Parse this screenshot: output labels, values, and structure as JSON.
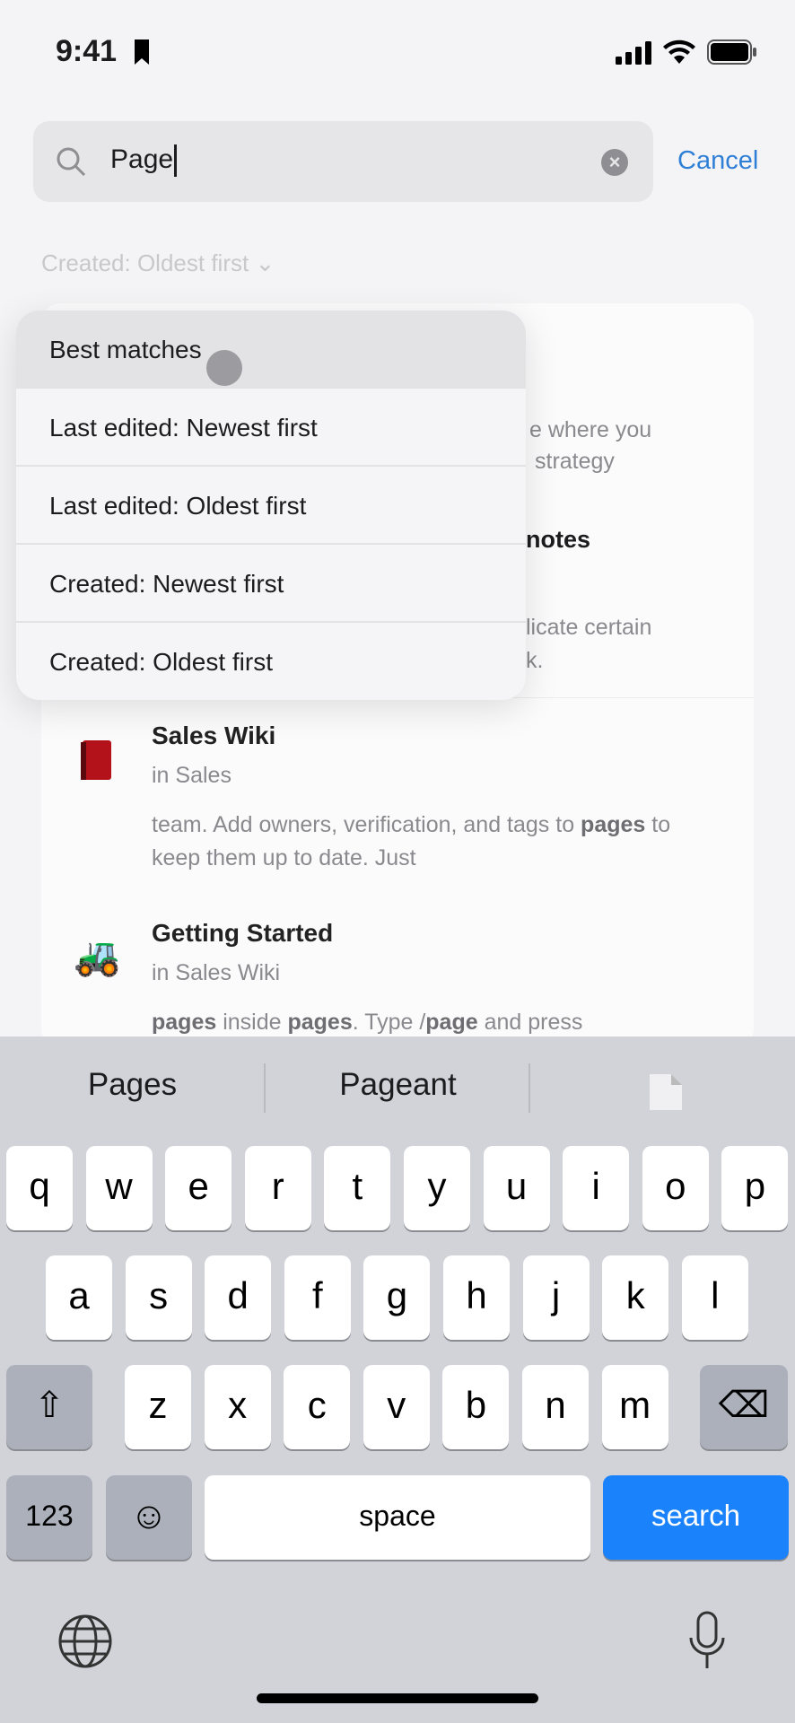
{
  "status": {
    "time": "9:41",
    "icons": [
      "bookmark-icon",
      "cellular-signal-icon",
      "wifi-icon",
      "battery-icon"
    ]
  },
  "search": {
    "value": "Page",
    "cancel_label": "Cancel",
    "icon": "search-icon",
    "clear_icon": "clear-icon"
  },
  "sort": {
    "label": "Created: Oldest first"
  },
  "results": {
    "hidden_fragments": [
      "e where you",
      "strategy",
      "notes",
      "licate certain",
      "k."
    ],
    "items": [
      {
        "icon": "red-book-emoji",
        "title": "Sales Wiki",
        "location": "in Sales",
        "snippet_parts": [
          [
            "team. Add owners, verification, and tags to ",
            false
          ],
          [
            "pages",
            true
          ],
          [
            " to keep them up to date. Just",
            false
          ]
        ]
      },
      {
        "icon": "tractor-emoji",
        "title": "Getting Started",
        "location": "in Sales Wiki",
        "snippet_parts": [
          [
            "pages",
            true
          ],
          [
            " inside ",
            false
          ],
          [
            "pages",
            true
          ],
          [
            ". Type /",
            false
          ],
          [
            "page",
            true
          ],
          [
            " and press",
            false
          ]
        ]
      }
    ]
  },
  "dropdown": {
    "selected": 0,
    "items": [
      "Best matches",
      "Last edited: Newest first",
      "Last edited: Oldest first",
      "Created: Newest first",
      "Created: Oldest first"
    ]
  },
  "keyboard": {
    "suggestions": [
      "Pages",
      "Pageant"
    ],
    "row1": [
      "q",
      "w",
      "e",
      "r",
      "t",
      "y",
      "u",
      "i",
      "o",
      "p"
    ],
    "row2": [
      "a",
      "s",
      "d",
      "f",
      "g",
      "h",
      "j",
      "k",
      "l"
    ],
    "row3": [
      "z",
      "x",
      "c",
      "v",
      "b",
      "n",
      "m"
    ],
    "numbers_label": "123",
    "space_label": "space",
    "search_label": "search",
    "accent": "#1a82fb"
  }
}
